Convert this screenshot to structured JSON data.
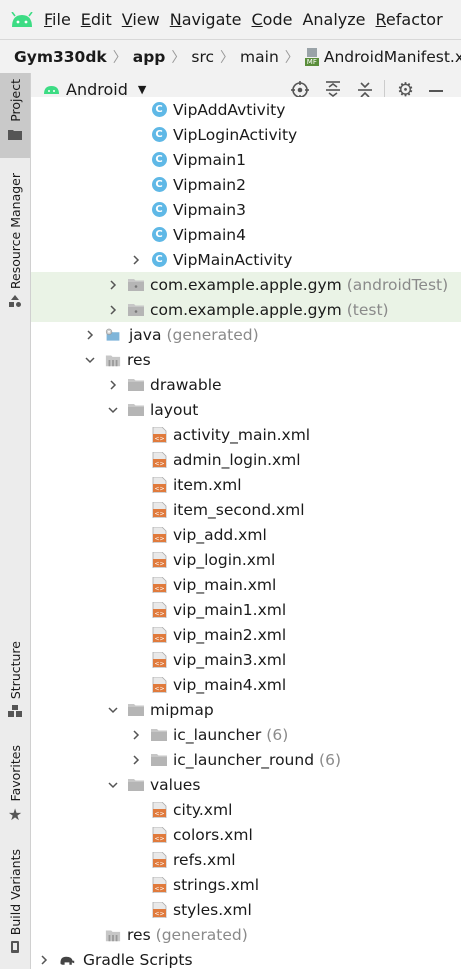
{
  "menu": {
    "items": [
      {
        "label": "File",
        "u": "F",
        "rest": "ile"
      },
      {
        "label": "Edit",
        "u": "E",
        "rest": "dit"
      },
      {
        "label": "View",
        "u": "V",
        "rest": "iew"
      },
      {
        "label": "Navigate",
        "u": "N",
        "rest": "avigate"
      },
      {
        "label": "Code",
        "u": "C",
        "rest": "ode"
      },
      {
        "label": "Analyze",
        "u": "",
        "rest": "Analyze"
      },
      {
        "label": "Refactor",
        "u": "R",
        "rest": "efactor"
      }
    ]
  },
  "breadcrumb": {
    "project": "Gym330dk",
    "module": "app",
    "dir1": "src",
    "dir2": "main",
    "file": "AndroidManifest.xml",
    "file_badge": "MF"
  },
  "side_tabs": {
    "project": "Project",
    "resource_manager": "Resource Manager",
    "structure": "Structure",
    "favorites": "Favorites",
    "build_variants": "Build Variants"
  },
  "panel": {
    "view_mode": "Android"
  },
  "tree": [
    {
      "label": "VipAddAvtivity",
      "suffix": "",
      "kind": "class",
      "level": 4,
      "arrow": "none",
      "hl": false
    },
    {
      "label": "VipLoginActivity",
      "suffix": "",
      "kind": "class",
      "level": 4,
      "arrow": "none",
      "hl": false
    },
    {
      "label": "Vipmain1",
      "suffix": "",
      "kind": "class",
      "level": 4,
      "arrow": "none",
      "hl": false
    },
    {
      "label": "Vipmain2",
      "suffix": "",
      "kind": "class",
      "level": 4,
      "arrow": "none",
      "hl": false
    },
    {
      "label": "Vipmain3",
      "suffix": "",
      "kind": "class",
      "level": 4,
      "arrow": "none",
      "hl": false
    },
    {
      "label": "Vipmain4",
      "suffix": "",
      "kind": "class",
      "level": 4,
      "arrow": "none",
      "hl": false
    },
    {
      "label": "VipMainActivity",
      "suffix": "",
      "kind": "class",
      "level": 4,
      "arrow": "right",
      "hl": false
    },
    {
      "label": "com.example.apple.gym",
      "suffix": "(androidTest)",
      "kind": "package",
      "level": 3,
      "arrow": "right",
      "hl": true
    },
    {
      "label": "com.example.apple.gym",
      "suffix": "(test)",
      "kind": "package",
      "level": 3,
      "arrow": "right",
      "hl": true
    },
    {
      "label": "java",
      "suffix": "(generated)",
      "kind": "javagen",
      "level": 2,
      "arrow": "right",
      "hl": false
    },
    {
      "label": "res",
      "suffix": "",
      "kind": "res",
      "level": 2,
      "arrow": "down",
      "hl": false
    },
    {
      "label": "drawable",
      "suffix": "",
      "kind": "folder",
      "level": 3,
      "arrow": "right",
      "hl": false
    },
    {
      "label": "layout",
      "suffix": "",
      "kind": "folder",
      "level": 3,
      "arrow": "down",
      "hl": false
    },
    {
      "label": "activity_main.xml",
      "suffix": "",
      "kind": "xml",
      "level": 4,
      "arrow": "none",
      "hl": false
    },
    {
      "label": "admin_login.xml",
      "suffix": "",
      "kind": "xml",
      "level": 4,
      "arrow": "none",
      "hl": false
    },
    {
      "label": "item.xml",
      "suffix": "",
      "kind": "xml",
      "level": 4,
      "arrow": "none",
      "hl": false
    },
    {
      "label": "item_second.xml",
      "suffix": "",
      "kind": "xml",
      "level": 4,
      "arrow": "none",
      "hl": false
    },
    {
      "label": "vip_add.xml",
      "suffix": "",
      "kind": "xml",
      "level": 4,
      "arrow": "none",
      "hl": false
    },
    {
      "label": "vip_login.xml",
      "suffix": "",
      "kind": "xml",
      "level": 4,
      "arrow": "none",
      "hl": false
    },
    {
      "label": "vip_main.xml",
      "suffix": "",
      "kind": "xml",
      "level": 4,
      "arrow": "none",
      "hl": false
    },
    {
      "label": "vip_main1.xml",
      "suffix": "",
      "kind": "xml",
      "level": 4,
      "arrow": "none",
      "hl": false
    },
    {
      "label": "vip_main2.xml",
      "suffix": "",
      "kind": "xml",
      "level": 4,
      "arrow": "none",
      "hl": false
    },
    {
      "label": "vip_main3.xml",
      "suffix": "",
      "kind": "xml",
      "level": 4,
      "arrow": "none",
      "hl": false
    },
    {
      "label": "vip_main4.xml",
      "suffix": "",
      "kind": "xml",
      "level": 4,
      "arrow": "none",
      "hl": false
    },
    {
      "label": "mipmap",
      "suffix": "",
      "kind": "folder",
      "level": 3,
      "arrow": "down",
      "hl": false
    },
    {
      "label": "ic_launcher",
      "suffix": "(6)",
      "kind": "folder",
      "level": 4,
      "arrow": "right",
      "hl": false
    },
    {
      "label": "ic_launcher_round",
      "suffix": "(6)",
      "kind": "folder",
      "level": 4,
      "arrow": "right",
      "hl": false
    },
    {
      "label": "values",
      "suffix": "",
      "kind": "folder",
      "level": 3,
      "arrow": "down",
      "hl": false
    },
    {
      "label": "city.xml",
      "suffix": "",
      "kind": "xml",
      "level": 4,
      "arrow": "none",
      "hl": false
    },
    {
      "label": "colors.xml",
      "suffix": "",
      "kind": "xml",
      "level": 4,
      "arrow": "none",
      "hl": false
    },
    {
      "label": "refs.xml",
      "suffix": "",
      "kind": "xml",
      "level": 4,
      "arrow": "none",
      "hl": false
    },
    {
      "label": "strings.xml",
      "suffix": "",
      "kind": "xml",
      "level": 4,
      "arrow": "none",
      "hl": false
    },
    {
      "label": "styles.xml",
      "suffix": "",
      "kind": "xml",
      "level": 4,
      "arrow": "none",
      "hl": false
    },
    {
      "label": "res",
      "suffix": "(generated)",
      "kind": "resgen",
      "level": 2,
      "arrow": "none",
      "hl": false
    },
    {
      "label": "Gradle Scripts",
      "suffix": "",
      "kind": "gradle",
      "level": 0,
      "arrow": "right",
      "hl": false
    }
  ],
  "colors": {
    "android_green": "#3ddc84",
    "class_icon": "#5fb8e6",
    "xml_icon": "#e07a3c",
    "highlight_row": "#eaf3e6"
  }
}
